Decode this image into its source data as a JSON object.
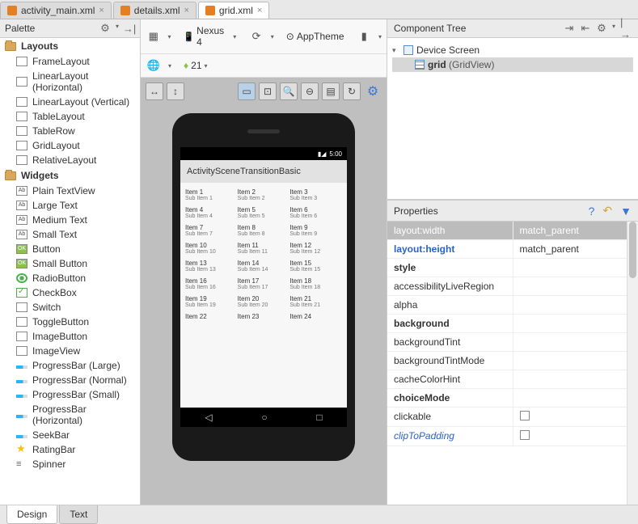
{
  "tabs": [
    {
      "label": "activity_main.xml",
      "active": false
    },
    {
      "label": "details.xml",
      "active": false
    },
    {
      "label": "grid.xml",
      "active": true
    }
  ],
  "palette": {
    "title": "Palette",
    "groups": [
      {
        "label": "Layouts",
        "items": [
          "FrameLayout",
          "LinearLayout (Horizontal)",
          "LinearLayout (Vertical)",
          "TableLayout",
          "TableRow",
          "GridLayout",
          "RelativeLayout"
        ]
      },
      {
        "label": "Widgets",
        "items": [
          "Plain TextView",
          "Large Text",
          "Medium Text",
          "Small Text",
          "Button",
          "Small Button",
          "RadioButton",
          "CheckBox",
          "Switch",
          "ToggleButton",
          "ImageButton",
          "ImageView",
          "ProgressBar (Large)",
          "ProgressBar (Normal)",
          "ProgressBar (Small)",
          "ProgressBar (Horizontal)",
          "SeekBar",
          "RatingBar",
          "Spinner"
        ]
      }
    ]
  },
  "toolbar": {
    "device": "Nexus 4",
    "theme": "AppTheme",
    "api": "21"
  },
  "preview": {
    "time": "5:00",
    "app_title": "ActivitySceneTransitionBasic",
    "grid_items": [
      [
        {
          "t": "Item 1",
          "s": "Sub Item 1"
        },
        {
          "t": "Item 2",
          "s": "Sub Item 2"
        },
        {
          "t": "Item 3",
          "s": "Sub Item 3"
        }
      ],
      [
        {
          "t": "Item 4",
          "s": "Sub Item 4"
        },
        {
          "t": "Item 5",
          "s": "Sub Item 5"
        },
        {
          "t": "Item 6",
          "s": "Sub Item 6"
        }
      ],
      [
        {
          "t": "Item 7",
          "s": "Sub Item 7"
        },
        {
          "t": "Item 8",
          "s": "Sub Item 8"
        },
        {
          "t": "Item 9",
          "s": "Sub Item 9"
        }
      ],
      [
        {
          "t": "Item 10",
          "s": "Sub Item 10"
        },
        {
          "t": "Item 11",
          "s": "Sub Item 11"
        },
        {
          "t": "Item 12",
          "s": "Sub Item 12"
        }
      ],
      [
        {
          "t": "Item 13",
          "s": "Sub Item 13"
        },
        {
          "t": "Item 14",
          "s": "Sub Item 14"
        },
        {
          "t": "Item 15",
          "s": "Sub Item 15"
        }
      ],
      [
        {
          "t": "Item 16",
          "s": "Sub Item 16"
        },
        {
          "t": "Item 17",
          "s": "Sub Item 17"
        },
        {
          "t": "Item 18",
          "s": "Sub Item 18"
        }
      ],
      [
        {
          "t": "Item 19",
          "s": "Sub Item 19"
        },
        {
          "t": "Item 20",
          "s": "Sub Item 20"
        },
        {
          "t": "Item 21",
          "s": "Sub Item 21"
        }
      ],
      [
        {
          "t": "Item 22",
          "s": ""
        },
        {
          "t": "Item 23",
          "s": ""
        },
        {
          "t": "Item 24",
          "s": ""
        }
      ]
    ]
  },
  "component_tree": {
    "title": "Component Tree",
    "root": "Device Screen",
    "child": "grid",
    "child_type": "(GridView)"
  },
  "properties": {
    "title": "Properties",
    "rows": [
      {
        "name": "layout:width",
        "value": "match_parent",
        "style": "selected"
      },
      {
        "name": "layout:height",
        "value": "match_parent",
        "style": "blue"
      },
      {
        "name": "style",
        "value": "",
        "style": "bold"
      },
      {
        "name": "accessibilityLiveRegion",
        "value": "",
        "style": ""
      },
      {
        "name": "alpha",
        "value": "",
        "style": ""
      },
      {
        "name": "background",
        "value": "",
        "style": "bold"
      },
      {
        "name": "backgroundTint",
        "value": "",
        "style": ""
      },
      {
        "name": "backgroundTintMode",
        "value": "",
        "style": ""
      },
      {
        "name": "cacheColorHint",
        "value": "",
        "style": ""
      },
      {
        "name": "choiceMode",
        "value": "",
        "style": "bold"
      },
      {
        "name": "clickable",
        "value": "checkbox",
        "style": ""
      },
      {
        "name": "clipToPadding",
        "value": "checkbox",
        "style": "italic-blue"
      }
    ]
  },
  "bottom_tabs": {
    "design": "Design",
    "text": "Text"
  }
}
